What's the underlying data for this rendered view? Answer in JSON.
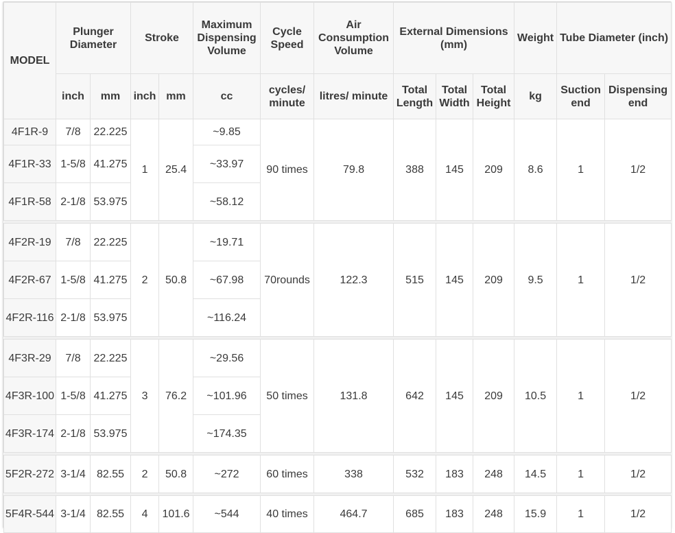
{
  "headers": {
    "model": "MODEL",
    "plunger": "Plunger Diameter",
    "stroke": "Stroke",
    "maxvol": "Maximum Dispensing Volume",
    "cycle": "Cycle Speed",
    "air": "Air Consumption Volume",
    "ext": "External Dimensions (mm)",
    "weight": "Weight",
    "tube": "Tube Diameter (inch)"
  },
  "subheaders": {
    "inch": "inch",
    "mm": "mm",
    "cc": "cc",
    "cycles_minute": "cycles/ minute",
    "litres_minute": "litres/ minute",
    "total_length": "Total Length",
    "total_width": "Total Width",
    "total_height": "Total Height",
    "kg": "kg",
    "suction": "Suction end",
    "dispensing": "Dispensing end"
  },
  "groups": [
    {
      "stroke_inch": "1",
      "stroke_mm": "25.4",
      "cycle": "90 times",
      "air": "79.8",
      "length": "388",
      "width": "145",
      "height": "209",
      "weight": "8.6",
      "suction": "1",
      "dispensing": "1/2",
      "rows": [
        {
          "model": "4F1R-9",
          "inch": "7/8",
          "mm": "22.225",
          "cc": "~9.85"
        },
        {
          "model": "4F1R-33",
          "inch": "1-5/8",
          "mm": "41.275",
          "cc": "~33.97"
        },
        {
          "model": "4F1R-58",
          "inch": "2-1/8",
          "mm": "53.975",
          "cc": "~58.12"
        }
      ]
    },
    {
      "stroke_inch": "2",
      "stroke_mm": "50.8",
      "cycle": "70rounds",
      "air": "122.3",
      "length": "515",
      "width": "145",
      "height": "209",
      "weight": "9.5",
      "suction": "1",
      "dispensing": "1/2",
      "rows": [
        {
          "model": "4F2R-19",
          "inch": "7/8",
          "mm": "22.225",
          "cc": "~19.71"
        },
        {
          "model": "4F2R-67",
          "inch": "1-5/8",
          "mm": "41.275",
          "cc": "~67.98"
        },
        {
          "model": "4F2R-116",
          "inch": "2-1/8",
          "mm": "53.975",
          "cc": "~116.24"
        }
      ]
    },
    {
      "stroke_inch": "3",
      "stroke_mm": "76.2",
      "cycle": "50 times",
      "air": "131.8",
      "length": "642",
      "width": "145",
      "height": "209",
      "weight": "10.5",
      "suction": "1",
      "dispensing": "1/2",
      "rows": [
        {
          "model": "4F3R-29",
          "inch": "7/8",
          "mm": "22.225",
          "cc": "~29.56"
        },
        {
          "model": "4F3R-100",
          "inch": "1-5/8",
          "mm": "41.275",
          "cc": "~101.96"
        },
        {
          "model": "4F3R-174",
          "inch": "2-1/8",
          "mm": "53.975",
          "cc": "~174.35"
        }
      ]
    }
  ],
  "singles": [
    {
      "model": "5F2R-272",
      "inch": "3-1/4",
      "mm": "82.55",
      "stroke_inch": "2",
      "stroke_mm": "50.8",
      "cc": "~272",
      "cycle": "60 times",
      "air": "338",
      "length": "532",
      "width": "183",
      "height": "248",
      "weight": "14.5",
      "suction": "1",
      "dispensing": "1/2"
    },
    {
      "model": "5F4R-544",
      "inch": "3-1/4",
      "mm": "82.55",
      "stroke_inch": "4",
      "stroke_mm": "101.6",
      "cc": "~544",
      "cycle": "40 times",
      "air": "464.7",
      "length": "685",
      "width": "183",
      "height": "248",
      "weight": "15.9",
      "suction": "1",
      "dispensing": "1/2"
    }
  ]
}
